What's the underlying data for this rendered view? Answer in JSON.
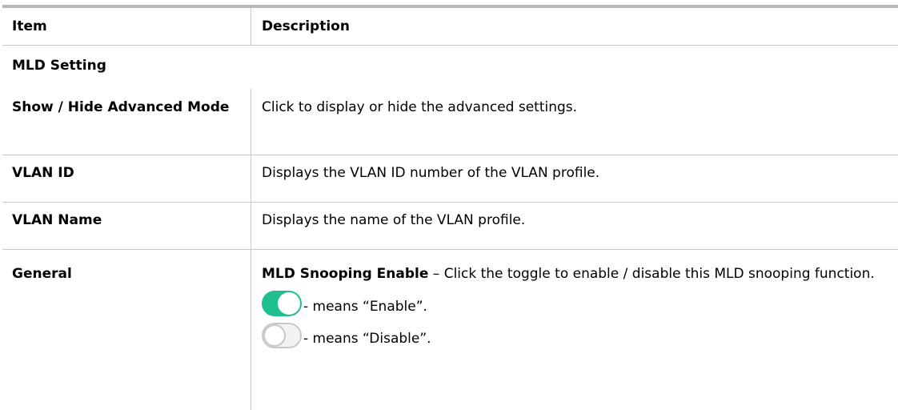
{
  "header": {
    "item": "Item",
    "description": "Description"
  },
  "section_title": "MLD Setting",
  "rows": [
    {
      "item": "Show / Hide Advanced Mode",
      "description": "Click to display or hide the advanced settings."
    },
    {
      "item": "VLAN ID",
      "description": "Displays the VLAN ID number of the VLAN profile."
    },
    {
      "item": "VLAN Name",
      "description": "Displays the name of the VLAN profile."
    }
  ],
  "general": {
    "item": "General",
    "term": "MLD Snooping Enable",
    "text": " – Click the toggle to enable / disable this MLD snooping function.",
    "enable_text": "- means “Enable”.",
    "disable_text": "- means “Disable”.",
    "toggle_on_color": "#1fbf8f",
    "toggle_off_color": "#c9c9c9"
  }
}
